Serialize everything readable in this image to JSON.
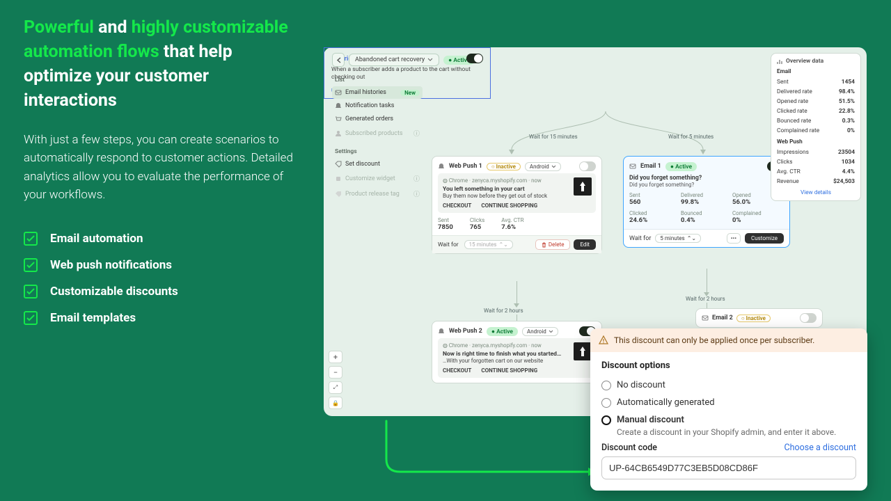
{
  "marketing": {
    "headline_pre": "Powerful",
    "headline_join1": " and ",
    "headline_mid": "highly customizable automation flows",
    "headline_post": " that help optimize your customer interactions",
    "body": "With just a few steps, you can create scenarios to automatically respond to customer actions. Detailed analytics allow you to evaluate the performance of your workflows.",
    "features": [
      "Email automation",
      "Web push notifications",
      "Customizable discounts",
      "Email templates"
    ]
  },
  "app": {
    "workflow_title": "Abandoned cart recovery",
    "active_badge": "Active",
    "sidebar": {
      "list_heading": "List",
      "settings_heading": "Settings",
      "list_items": [
        {
          "label": "Email histories",
          "badge": "New"
        },
        {
          "label": "Notification tasks"
        },
        {
          "label": "Generated orders"
        },
        {
          "label": "Subscribed products",
          "muted": true
        }
      ],
      "settings_items": [
        {
          "label": "Set discount"
        },
        {
          "label": "Customize widget",
          "muted": true
        },
        {
          "label": "Product release tag",
          "muted": true
        }
      ]
    },
    "trigger": {
      "title": "Trigger",
      "body": "When a subscriber adds a product to the cart without checking out",
      "learn_more": "Learn more"
    },
    "waits": {
      "left_branch": "Wait for 15 minutes",
      "right_branch": "Wait for 5 minutes",
      "after_push1": "Wait for 2 hours",
      "after_email1": "Wait for 2 hours"
    },
    "push1": {
      "title": "Web Push 1",
      "status": "Inactive",
      "platform": "Android",
      "preview": {
        "meta": "Chrome  ·  zenyca.myshopify.com  ·  now",
        "title": "You left something in your cart",
        "body": "Buy them now before they get out of stock",
        "cta1": "CHECKOUT",
        "cta2": "CONTINUE SHOPPING"
      },
      "stats": {
        "sent": "7850",
        "clicks": "765",
        "ctr": "7.6%"
      },
      "wait_for_label": "Wait for",
      "wait_value": "15 minutes",
      "delete": "Delete",
      "edit": "Edit"
    },
    "email1": {
      "title": "Email 1",
      "status": "Active",
      "subject": "Did you forget something?",
      "preview": "Did you forget something?",
      "metrics": {
        "sent_l": "Sent",
        "sent_v": "560",
        "del_l": "Delivered",
        "del_v": "99.8%",
        "open_l": "Opened",
        "open_v": "56.0%",
        "click_l": "Clicked",
        "click_v": "24.6%",
        "bounce_l": "Bounced",
        "bounce_v": "0.4%",
        "comp_l": "Complained",
        "comp_v": "0%"
      },
      "wait_for_label": "Wait for",
      "wait_value": "5 minutes",
      "customize": "Customize"
    },
    "push2": {
      "title": "Web Push 2",
      "status": "Active",
      "platform": "Android",
      "preview": {
        "meta": "Chrome  ·  zenyca.myshopify.com  ·  now",
        "title": "Now is right time to finish what you started…",
        "body": "…With your forgotten cart on our website",
        "cta1": "CHECKOUT",
        "cta2": "CONTINUE SHOPPING"
      }
    },
    "email2": {
      "title": "Email 2",
      "status": "Inactive"
    },
    "overview": {
      "heading": "Overview data",
      "email_h": "Email",
      "push_h": "Web Push",
      "rows_email": [
        [
          "Sent",
          "1454"
        ],
        [
          "Delivered rate",
          "98.4%"
        ],
        [
          "Opened rate",
          "51.5%"
        ],
        [
          "Clicked rate",
          "22.8%"
        ],
        [
          "Bounced rate",
          "0.3%"
        ],
        [
          "Complained rate",
          "0%"
        ]
      ],
      "rows_push": [
        [
          "Impressions",
          "23504"
        ],
        [
          "Clicks",
          "1034"
        ],
        [
          "Avg. CTR",
          "4.4%"
        ],
        [
          "Revenue",
          "$24,503"
        ]
      ],
      "view_details": "View details"
    },
    "stats_labels": {
      "sent": "Sent",
      "clicks": "Clicks",
      "ctr": "Avg. CTR"
    }
  },
  "discount": {
    "warning": "This discount can only be applied once per subscriber.",
    "heading": "Discount options",
    "options": {
      "none": "No discount",
      "auto": "Automatically generated",
      "manual": "Manual discount"
    },
    "manual_hint": "Create a discount in your Shopify admin, and enter it above.",
    "code_label": "Discount code",
    "choose_link": "Choose a discount",
    "code_value": "UP-64CB6549D77C3EB5D08CD86F"
  }
}
